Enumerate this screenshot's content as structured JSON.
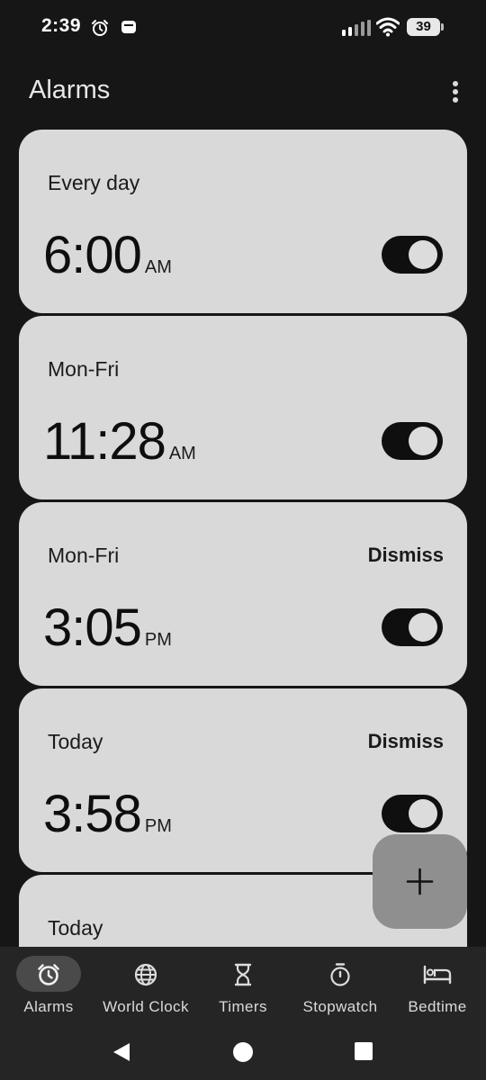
{
  "status_bar": {
    "time": "2:39",
    "battery": "39",
    "icons": [
      "alarm-clock-icon",
      "notification-icon",
      "signal-icon",
      "wifi-icon",
      "battery-icon"
    ]
  },
  "app_bar": {
    "title": "Alarms",
    "more_icon": "more-vert-icon"
  },
  "alarms": [
    {
      "days": "Every day",
      "time": "6:00",
      "ampm": "AM",
      "enabled": true,
      "dismiss": ""
    },
    {
      "days": "Mon-Fri",
      "time": "11:28",
      "ampm": "AM",
      "enabled": true,
      "dismiss": ""
    },
    {
      "days": "Mon-Fri",
      "time": "3:05",
      "ampm": "PM",
      "enabled": true,
      "dismiss": "Dismiss"
    },
    {
      "days": "Today",
      "time": "3:58",
      "ampm": "PM",
      "enabled": true,
      "dismiss": "Dismiss"
    },
    {
      "days": "Today"
    }
  ],
  "fab": {
    "icon": "plus-icon"
  },
  "bottom_nav": {
    "items": [
      {
        "label": "Alarms",
        "icon": "alarm-icon",
        "active": true
      },
      {
        "label": "World Clock",
        "icon": "globe-icon",
        "active": false
      },
      {
        "label": "Timers",
        "icon": "hourglass-icon",
        "active": false
      },
      {
        "label": "Stopwatch",
        "icon": "stopwatch-icon",
        "active": false
      },
      {
        "label": "Bedtime",
        "icon": "bed-icon",
        "active": false
      }
    ]
  },
  "system_nav": {
    "icons": [
      "back-icon",
      "home-icon",
      "recents-icon"
    ]
  },
  "colors": {
    "background": "#161616",
    "card": "#d9d9d9",
    "nav_bar": "#252525",
    "fab": "#8f8f8f",
    "toggle_on": "#0f0f0f"
  }
}
